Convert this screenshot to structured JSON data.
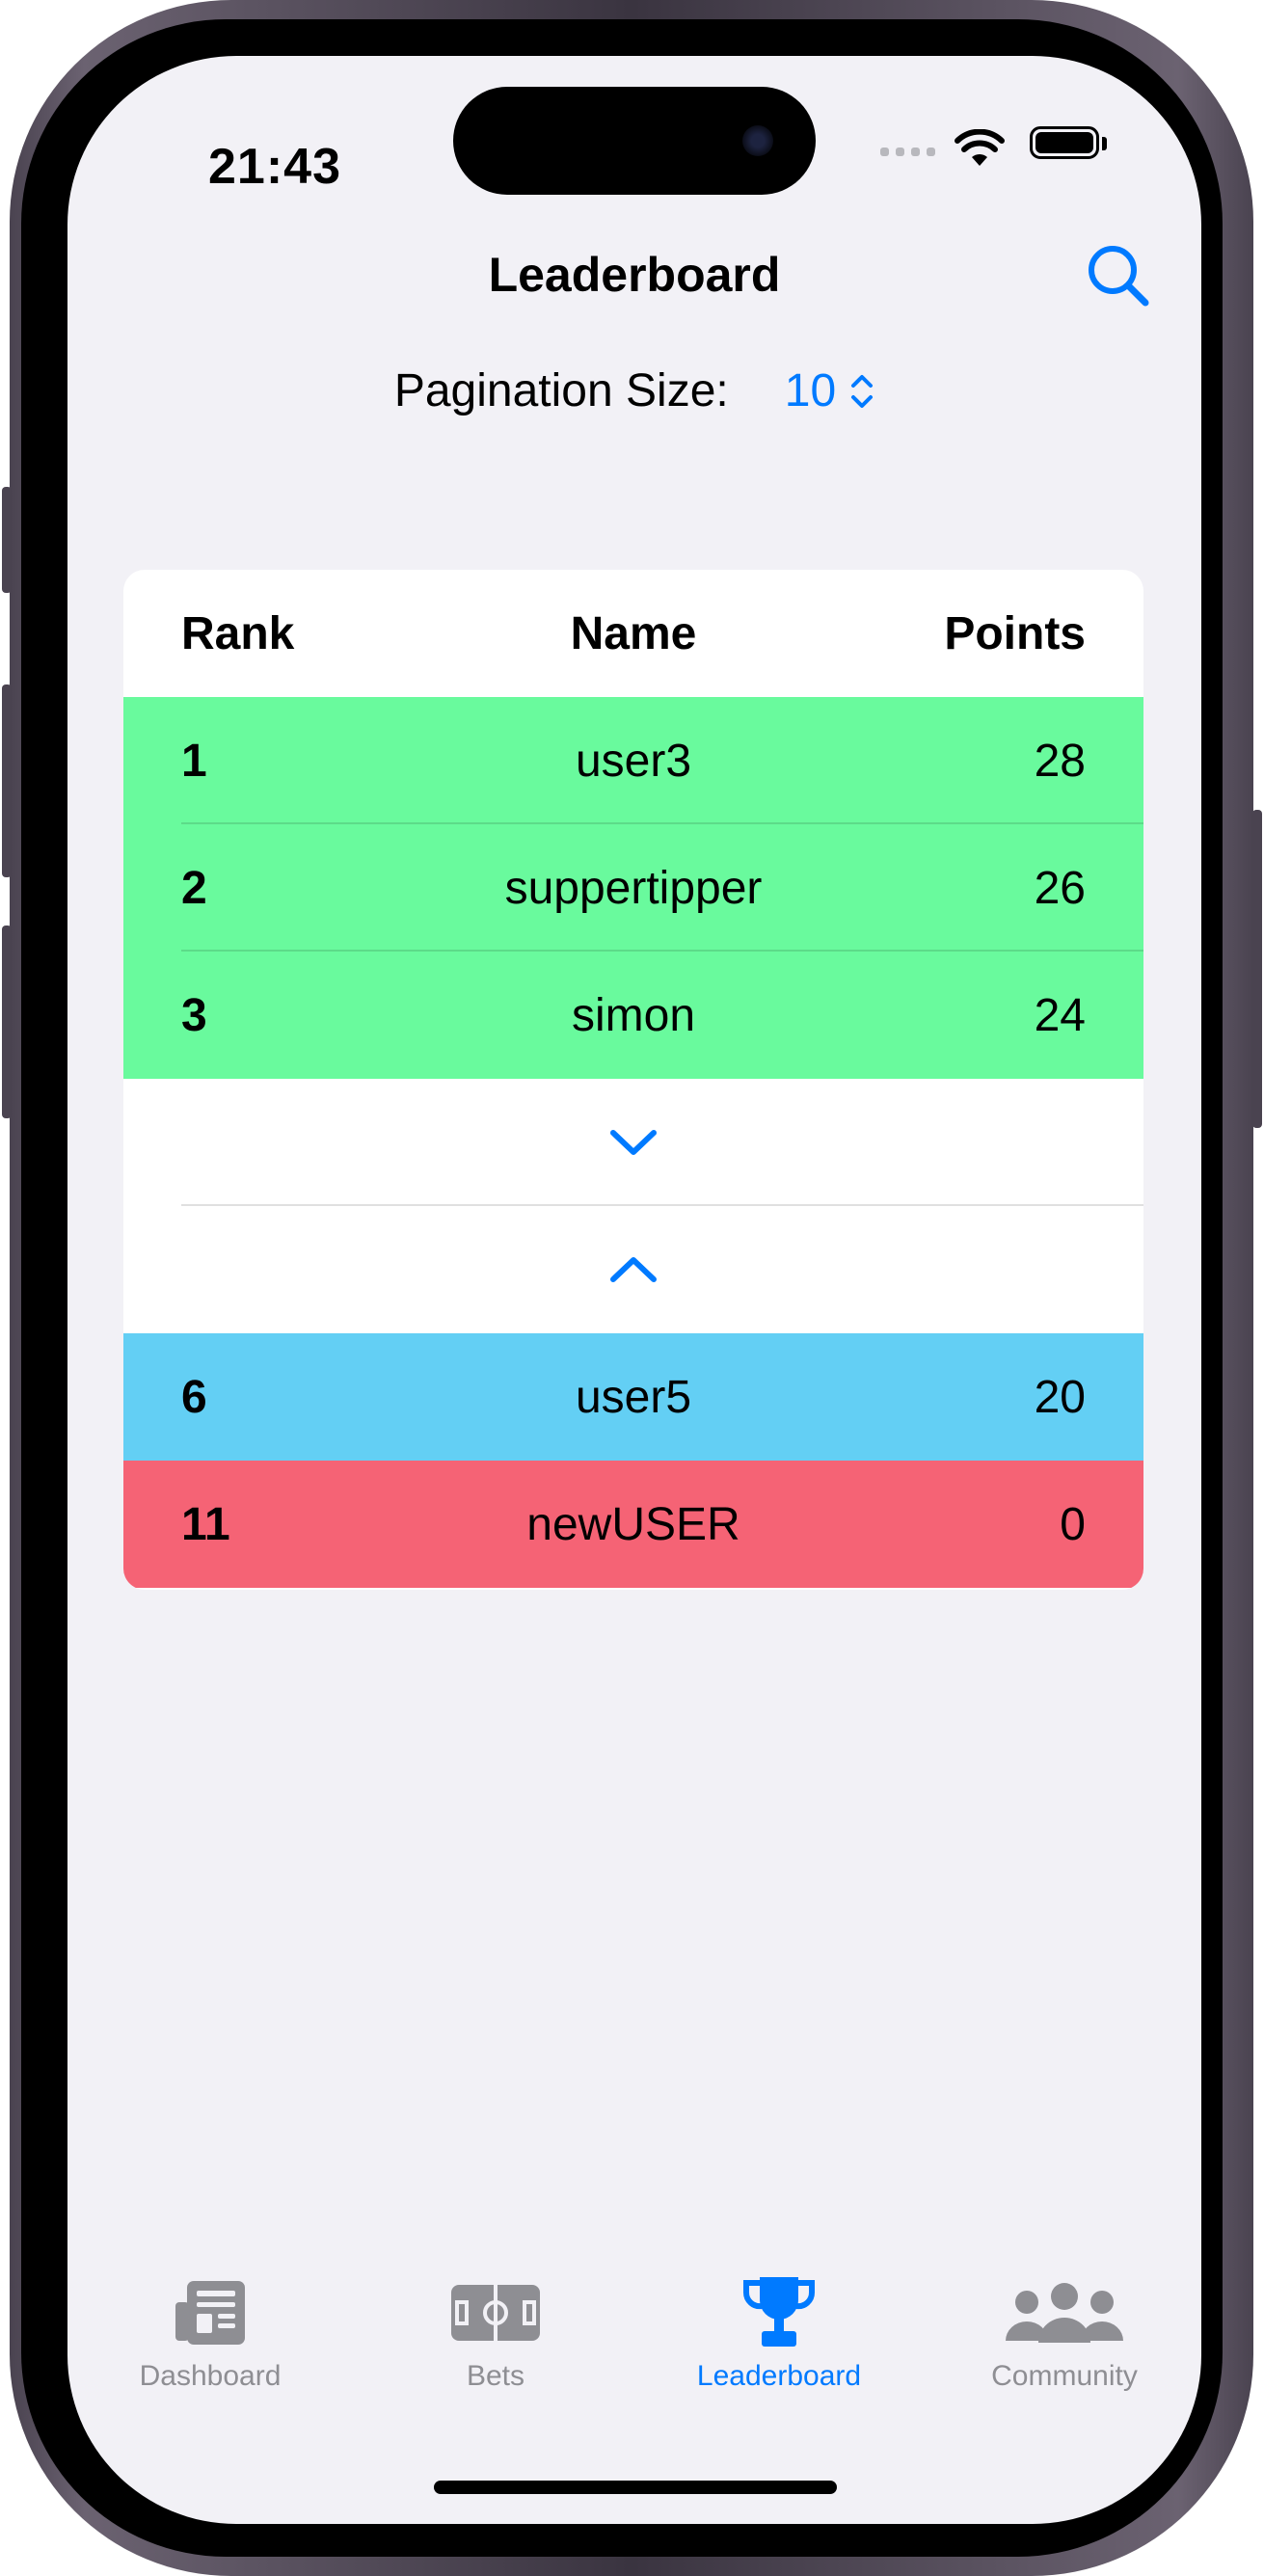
{
  "status_bar": {
    "time": "21:43"
  },
  "nav": {
    "title": "Leaderboard",
    "search_icon": "search-icon"
  },
  "pagination": {
    "label": "Pagination Size:",
    "value": "10"
  },
  "table": {
    "headers": {
      "rank": "Rank",
      "name": "Name",
      "points": "Points"
    },
    "top_rows": [
      {
        "rank": "1",
        "name": "user3",
        "points": "28"
      },
      {
        "rank": "2",
        "name": "suppertipper",
        "points": "26"
      },
      {
        "rank": "3",
        "name": "simon",
        "points": "24"
      }
    ],
    "expand_down_icon": "chevron-down-icon",
    "expand_up_icon": "chevron-up-icon",
    "current_user_row": {
      "rank": "6",
      "name": "user5",
      "points": "20"
    },
    "bottom_row": {
      "rank": "11",
      "name": "newUSER",
      "points": "0"
    },
    "colors": {
      "top": "#69fa9d",
      "current": "#63cff4",
      "bottom": "#f56375"
    }
  },
  "tabs": [
    {
      "label": "Dashboard",
      "icon": "newspaper-icon",
      "active": false
    },
    {
      "label": "Bets",
      "icon": "soccer-field-icon",
      "active": false
    },
    {
      "label": "Leaderboard",
      "icon": "trophy-icon",
      "active": true
    },
    {
      "label": "Community",
      "icon": "people-icon",
      "active": false
    }
  ],
  "accent_color": "#007aff"
}
